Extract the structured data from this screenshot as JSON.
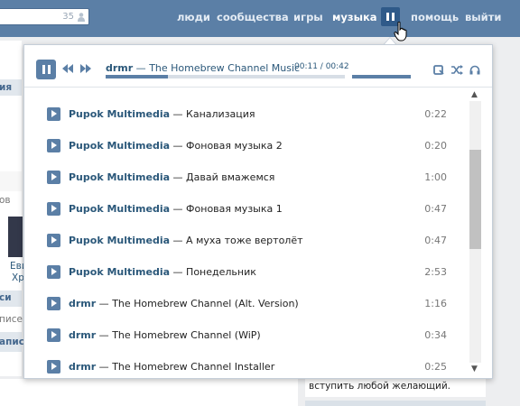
{
  "header": {
    "search_count": "35",
    "nav": [
      "люди",
      "сообщества",
      "игры",
      "музыка",
      "помощь",
      "выйти"
    ],
    "colors": {
      "bar": "#5b7fa6",
      "accent": "#2f5a89"
    }
  },
  "background": {
    "left_fragments": [
      "ия",
      "ов",
      "Еви",
      "Хр",
      "си",
      "писе",
      "аписи"
    ],
    "bottom_text": "вступить любой желающий."
  },
  "player": {
    "now_playing": {
      "artist": "drmr",
      "separator": " — ",
      "title": "The Homebrew Channel Music"
    },
    "time": "00:11 / 00:42",
    "progress": 0.26,
    "tracks": [
      {
        "artist": "Pupok Multimedia",
        "title": "Канализация",
        "duration": "0:22"
      },
      {
        "artist": "Pupok Multimedia",
        "title": "Фоновая музыка 2",
        "duration": "0:20"
      },
      {
        "artist": "Pupok Multimedia",
        "title": "Давай вмажемся",
        "duration": "1:00"
      },
      {
        "artist": "Pupok Multimedia",
        "title": "Фоновая музыка 1",
        "duration": "0:47"
      },
      {
        "artist": "Pupok Multimedia",
        "title": "А муха тоже вертолёт",
        "duration": "0:47"
      },
      {
        "artist": "Pupok Multimedia",
        "title": "Понедельник",
        "duration": "2:53"
      },
      {
        "artist": "drmr",
        "title": "The Homebrew Channel (Alt. Version)",
        "duration": "1:16"
      },
      {
        "artist": "drmr",
        "title": "The Homebrew Channel (WiP)",
        "duration": "0:34"
      },
      {
        "artist": "drmr",
        "title": "The Homebrew Channel Installer",
        "duration": "0:25"
      }
    ]
  }
}
